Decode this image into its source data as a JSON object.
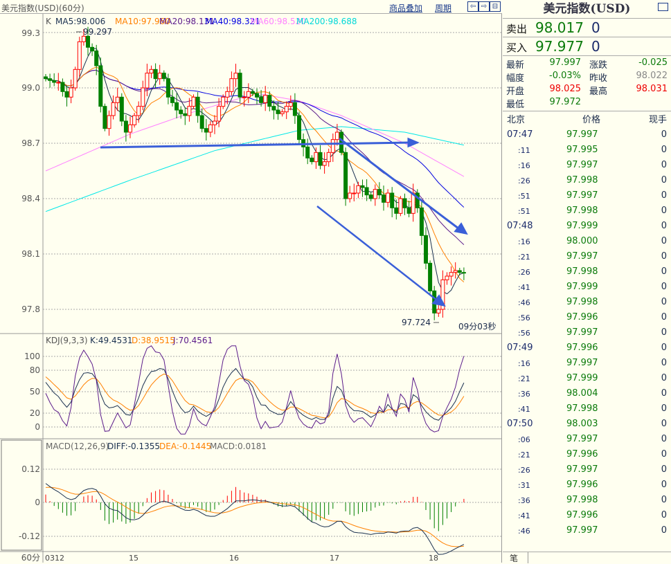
{
  "header": {
    "title": "美元指数(USD)(60分)",
    "overlay_link": "商品叠加",
    "period_link": "周期",
    "nav": [
      "⇦",
      "⇨",
      "⊟"
    ]
  },
  "main_legend": {
    "k": "K",
    "ma5": "MA5:98.006",
    "ma10": "MA10:97.960",
    "ma20": "MA20:98.131",
    "ma40": "MA40:98.321",
    "ma60": "MA60:98.520",
    "ma200": "MA200:98.688"
  },
  "colors": {
    "up": "#ff0000",
    "down": "#008000",
    "ma5": "#1a3050",
    "ma10": "#ff8000",
    "ma20": "#5a1a8a",
    "ma40": "#0000e0",
    "ma60": "#ff80ff",
    "ma200": "#00e8e8",
    "arrow": "#3a5fd8"
  },
  "price_axis": [
    "99.3",
    "99.0",
    "98.7",
    "98.4",
    "98.1",
    "97.8"
  ],
  "annotations": {
    "high": "99.297",
    "low": "97.724",
    "countdown": "09分03秒"
  },
  "kdj": {
    "label": "KDJ(9,3,3)",
    "k": "K:49.4531",
    "d": "D:38.9515",
    "j": "J:70.4561",
    "axis": [
      "100",
      "80",
      "50",
      "20",
      "0"
    ]
  },
  "macd": {
    "label": "MACD(12,26,9)",
    "diff": "DIFF:-0.1355",
    "dea": "DEA:-0.1445",
    "macd": "MACD:0.0181",
    "axis": [
      "0.12",
      "0",
      "-0.12"
    ]
  },
  "x_axis": {
    "unit": "60分",
    "dates": [
      "0312",
      "15",
      "16",
      "17",
      "18"
    ]
  },
  "chart_data": {
    "type": "candlestick",
    "closes": [
      99.05,
      99.04,
      99.03,
      99.03,
      98.98,
      98.95,
      99.0,
      99.1,
      99.25,
      99.28,
      99.22,
      99.2,
      99.12,
      98.9,
      98.78,
      98.85,
      98.92,
      98.95,
      98.82,
      98.76,
      98.8,
      98.85,
      98.9,
      99.0,
      99.08,
      99.1,
      99.05,
      99.08,
      99.05,
      98.95,
      98.92,
      98.88,
      98.86,
      98.85,
      98.9,
      98.95,
      98.85,
      98.78,
      98.76,
      98.8,
      98.82,
      98.9,
      98.95,
      98.98,
      99.05,
      99.08,
      98.95,
      98.95,
      98.98,
      98.97,
      98.95,
      98.92,
      98.96,
      98.9,
      98.88,
      98.86,
      98.87,
      98.9,
      98.92,
      98.85,
      98.72,
      98.68,
      98.62,
      98.6,
      98.65,
      98.58,
      98.6,
      98.65,
      98.72,
      98.76,
      98.65,
      98.4,
      98.43,
      98.43,
      98.47,
      98.46,
      98.42,
      98.4,
      98.45,
      98.42,
      98.38,
      98.43,
      98.35,
      98.32,
      98.4,
      98.35,
      98.32,
      98.43,
      98.35,
      98.2,
      98.05,
      97.9,
      97.78,
      97.8,
      97.96,
      97.98,
      98.0,
      98.01,
      98.0,
      97.997
    ],
    "ma60": [
      [
        0,
        98.55
      ],
      [
        20,
        98.75
      ],
      [
        35,
        98.87
      ],
      [
        50,
        98.97
      ],
      [
        60,
        98.93
      ],
      [
        70,
        98.85
      ],
      [
        85,
        98.7
      ],
      [
        99,
        98.52
      ]
    ],
    "ma200": [
      [
        0,
        98.33
      ],
      [
        20,
        98.5
      ],
      [
        40,
        98.66
      ],
      [
        60,
        98.77
      ],
      [
        70,
        98.79
      ],
      [
        85,
        98.76
      ],
      [
        99,
        98.69
      ]
    ],
    "ylim": [
      97.72,
      99.32
    ]
  },
  "quote": {
    "title": "美元指数(USD)",
    "sell_label": "卖出",
    "sell_price": "98.017",
    "sell_vol": "0",
    "buy_label": "买入",
    "buy_price": "97.977",
    "buy_vol": "0",
    "rows": [
      {
        "l": "最新",
        "v": "97.997",
        "c": "#0a7a0a"
      },
      {
        "l": "涨跌",
        "v": "-0.025",
        "c": "#0a7a0a"
      },
      {
        "l": "幅度",
        "v": "-0.03%",
        "c": "#0a7a0a"
      },
      {
        "l": "昨收",
        "v": "98.022",
        "c": "#888"
      },
      {
        "l": "开盘",
        "v": "98.025",
        "c": "#e00"
      },
      {
        "l": "最高",
        "v": "98.031",
        "c": "#e00"
      },
      {
        "l": "最低",
        "v": "97.972",
        "c": "#0a7a0a"
      }
    ]
  },
  "ticks_header": {
    "time": "北京",
    "price": "价格",
    "vol": "现手"
  },
  "ticks": [
    [
      "07:47",
      "97.997",
      "0"
    ],
    [
      ":11",
      "97.995",
      "0"
    ],
    [
      ":16",
      "97.997",
      "0"
    ],
    [
      ":26",
      "97.998",
      "0"
    ],
    [
      ":51",
      "97.997",
      "0"
    ],
    [
      ":51",
      "97.998",
      "0"
    ],
    [
      "07:48",
      "97.999",
      "0"
    ],
    [
      ":16",
      "98.000",
      "0"
    ],
    [
      ":21",
      "97.997",
      "0"
    ],
    [
      ":26",
      "97.998",
      "0"
    ],
    [
      ":41",
      "97.999",
      "0"
    ],
    [
      ":46",
      "97.998",
      "0"
    ],
    [
      ":56",
      "97.996",
      "0"
    ],
    [
      ":56",
      "97.997",
      "0"
    ],
    [
      "07:49",
      "97.996",
      "0"
    ],
    [
      ":16",
      "97.997",
      "0"
    ],
    [
      ":21",
      "97.999",
      "0"
    ],
    [
      ":36",
      "98.004",
      "0"
    ],
    [
      ":41",
      "97.998",
      "0"
    ],
    [
      "07:50",
      "98.003",
      "0"
    ],
    [
      ":06",
      "97.997",
      "0"
    ],
    [
      ":21",
      "97.996",
      "0"
    ],
    [
      ":26",
      "97.997",
      "0"
    ],
    [
      ":31",
      "97.996",
      "0"
    ],
    [
      ":36",
      "97.998",
      "0"
    ],
    [
      ":41",
      "97.996",
      "0"
    ],
    [
      ":46",
      "97.997",
      "0"
    ]
  ],
  "footer_tab": "笔"
}
